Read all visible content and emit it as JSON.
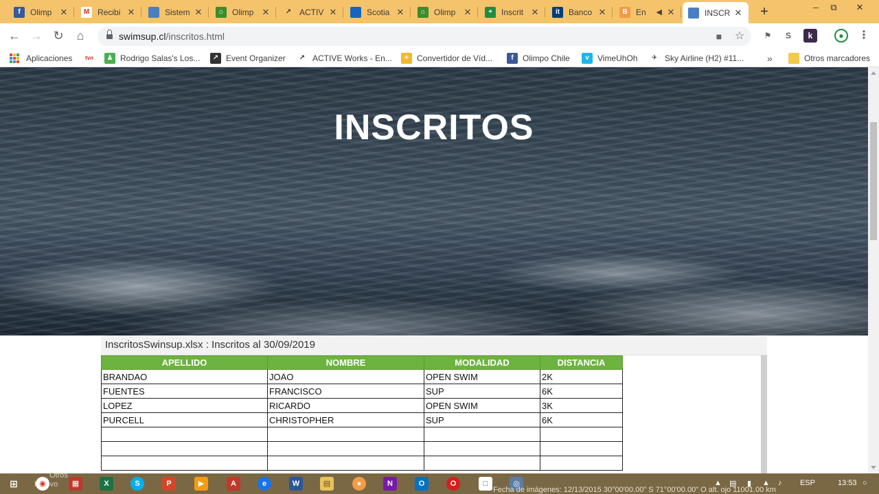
{
  "browser": {
    "tabs": [
      {
        "title": "Olimp",
        "icon": "facebook-icon",
        "color": "#3b5998",
        "glyph": "f"
      },
      {
        "title": "Recibi",
        "icon": "gmail-icon",
        "color": "#ffffff",
        "glyph": "M"
      },
      {
        "title": "Sistem",
        "icon": "site-icon",
        "color": "#4a7fc1",
        "glyph": ""
      },
      {
        "title": "Olimp",
        "icon": "olimpo-icon",
        "color": "#3c8c2c",
        "glyph": "⌂"
      },
      {
        "title": "ACTIV",
        "icon": "active-icon",
        "color": "#f5c36b",
        "glyph": "↗"
      },
      {
        "title": "Scotia",
        "icon": "scotia-icon",
        "color": "#1565c0",
        "glyph": ""
      },
      {
        "title": "Olimp",
        "icon": "olimpo-icon",
        "color": "#3c8c2c",
        "glyph": "⌂"
      },
      {
        "title": "Inscrit",
        "icon": "sheet-plus-icon",
        "color": "#1e8e3e",
        "glyph": "+"
      },
      {
        "title": "Banco",
        "icon": "itau-icon",
        "color": "#003d7c",
        "glyph": "it"
      },
      {
        "title": "En",
        "icon": "bm-icon",
        "color": "#f39c45",
        "glyph": "B"
      },
      {
        "title": "INSCR",
        "icon": "site-icon",
        "color": "#4a7fc1",
        "glyph": "",
        "active": true
      }
    ],
    "url_host": "swimsup.cl",
    "url_path": "/inscritos.html",
    "bookmarks": [
      {
        "label": "Aplicaciones",
        "icon": "apps-grid-icon"
      },
      {
        "label": "",
        "icon": "tvn-icon",
        "color": "#d62828",
        "glyph": "tvn"
      },
      {
        "label": "Rodrigo Salas's Los...",
        "icon": "runner-icon",
        "color": "#4caf50",
        "glyph": "♟"
      },
      {
        "label": "Event Organizer",
        "icon": "event-organizer-icon",
        "color": "#333333",
        "glyph": "↗"
      },
      {
        "label": "ACTIVE Works - En...",
        "icon": "active-icon",
        "color": "#ffffff",
        "glyph": "↗"
      },
      {
        "label": "Convertidor de Víd...",
        "icon": "converter-icon",
        "color": "#f2b82a",
        "glyph": "☀"
      },
      {
        "label": "Olimpo Chile",
        "icon": "facebook-icon",
        "color": "#3b5998",
        "glyph": "f"
      },
      {
        "label": "VimeUhOh",
        "icon": "vimeo-icon",
        "color": "#1ab7ea",
        "glyph": "v"
      },
      {
        "label": "Sky Airline (H2) #11...",
        "icon": "plane-icon",
        "color": "#ffffff",
        "glyph": "✈"
      }
    ],
    "other_bookmarks": "Otros marcadores",
    "more_bookmarks": "»"
  },
  "page": {
    "title": "INSCRITOS",
    "sheet_caption": "InscritosSwinsup.xlsx : Inscritos al 30/09/2019",
    "table": {
      "headers": [
        "APELLIDO",
        "NOMBRE",
        "MODALIDAD",
        "DISTANCIA"
      ],
      "rows": [
        [
          "BRANDAO",
          "JOAO",
          "OPEN SWIM",
          "2K"
        ],
        [
          "FUENTES",
          "FRANCISCO",
          "SUP",
          "6K"
        ],
        [
          "LOPEZ",
          "RICARDO",
          "OPEN SWIM",
          "3K"
        ],
        [
          "PURCELL",
          "CHRISTOPHER",
          "SUP",
          "6K"
        ],
        [
          "",
          "",
          "",
          ""
        ],
        [
          "",
          "",
          "",
          ""
        ],
        [
          "",
          "",
          "",
          ""
        ]
      ]
    }
  },
  "taskbar": {
    "desktop_text_1": "Otros",
    "desktop_text_2": "Relevo",
    "status_text": "Fecha de imágenes: 12/13/2015   30°00'00.00\" S   71°00'00.00\" O   alt. ojo 11001.00 km",
    "language": "ESP",
    "time": "13:53"
  }
}
